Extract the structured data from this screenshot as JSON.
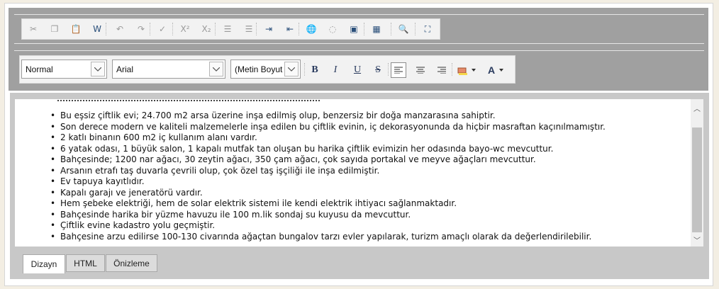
{
  "toolbar_row1": [
    {
      "name": "cut-icon",
      "glyph": "✂"
    },
    {
      "name": "copy-icon",
      "glyph": "❐"
    },
    {
      "name": "paste-icon",
      "glyph": "📋"
    },
    {
      "name": "paste-word-icon",
      "glyph": "W"
    },
    {
      "name": "undo-icon",
      "glyph": "↶"
    },
    {
      "name": "redo-icon",
      "glyph": "↷"
    },
    {
      "name": "spellcheck-icon",
      "glyph": "✓"
    },
    {
      "name": "superscript-icon",
      "glyph": "X²"
    },
    {
      "name": "subscript-icon",
      "glyph": "X₂"
    },
    {
      "name": "ordered-list-icon",
      "glyph": "☰"
    },
    {
      "name": "unordered-list-icon",
      "glyph": "☰"
    },
    {
      "name": "indent-icon",
      "glyph": "⇥"
    },
    {
      "name": "outdent-icon",
      "glyph": "⇤"
    },
    {
      "name": "insert-link-icon",
      "glyph": "🌐"
    },
    {
      "name": "remove-link-icon",
      "glyph": "◌"
    },
    {
      "name": "insert-image-icon",
      "glyph": "▣"
    },
    {
      "name": "insert-table-icon",
      "glyph": "▦"
    },
    {
      "name": "find-replace-icon",
      "glyph": "🔍"
    },
    {
      "name": "fullscreen-icon",
      "glyph": "⛶"
    }
  ],
  "format": {
    "paragraph_style": "Normal",
    "font_name": "Arial",
    "font_size": "(Metin Boyut",
    "bold": "B",
    "italic": "I",
    "underline": "U",
    "strike": "S",
    "font_color": "A"
  },
  "content": {
    "items": [
      "Bu eşsiz çiftlik evi; 24.700 m2 arsa üzerine inşa edilmiş olup, benzersiz bir doğa manzarasına sahiptir.",
      "Son derece modern ve kaliteli malzemelerle inşa edilen bu çiftlik evinin, iç dekorasyonunda da hiçbir masraftan kaçınılmamıştır.",
      "2 katlı binanın 600 m2 iç kullanım alanı vardır.",
      "6 yatak odası, 1 büyük salon, 1 kapalı mutfak tan oluşan bu harika çiftlik evimizin her odasında bayo-wc mevcuttur.",
      "Bahçesinde; 1200 nar ağacı, 30 zeytin ağacı, 350 çam ağacı, çok sayıda portakal ve meyve ağaçları mevcuttur.",
      "Arsanın etrafı taş duvarla çevrili olup, çok özel taş işçiliği ile inşa edilmiştir.",
      "Ev tapuya kayıtlıdır.",
      "Kapalı garajı ve jeneratörü vardır.",
      "Hem şebeke elektriği, hem de solar elektrik sistemi ile kendi elektrik ihtiyacı sağlanmaktadır.",
      "Bahçesinde harika bir yüzme havuzu ile 100 m.lik sondaj su kuyusu da mevcuttur.",
      "Çiftlik evine kadastro yolu geçmiştir.",
      "Bahçesine arzu edilirse 100-130 civarında ağaçtan bungalov tarzı evler yapılarak, turizm amaçlı olarak da değerlendirilebilir."
    ]
  },
  "tabs": {
    "design": "Dizayn",
    "html": "HTML",
    "preview": "Önizleme",
    "active": "Dizayn"
  },
  "colors": {
    "toolbar_bg": "#a0a0a0",
    "strip_bg": "#f2f2f2",
    "editor_border": "#c8c8c8",
    "icon_active": "#2a4f7a"
  }
}
